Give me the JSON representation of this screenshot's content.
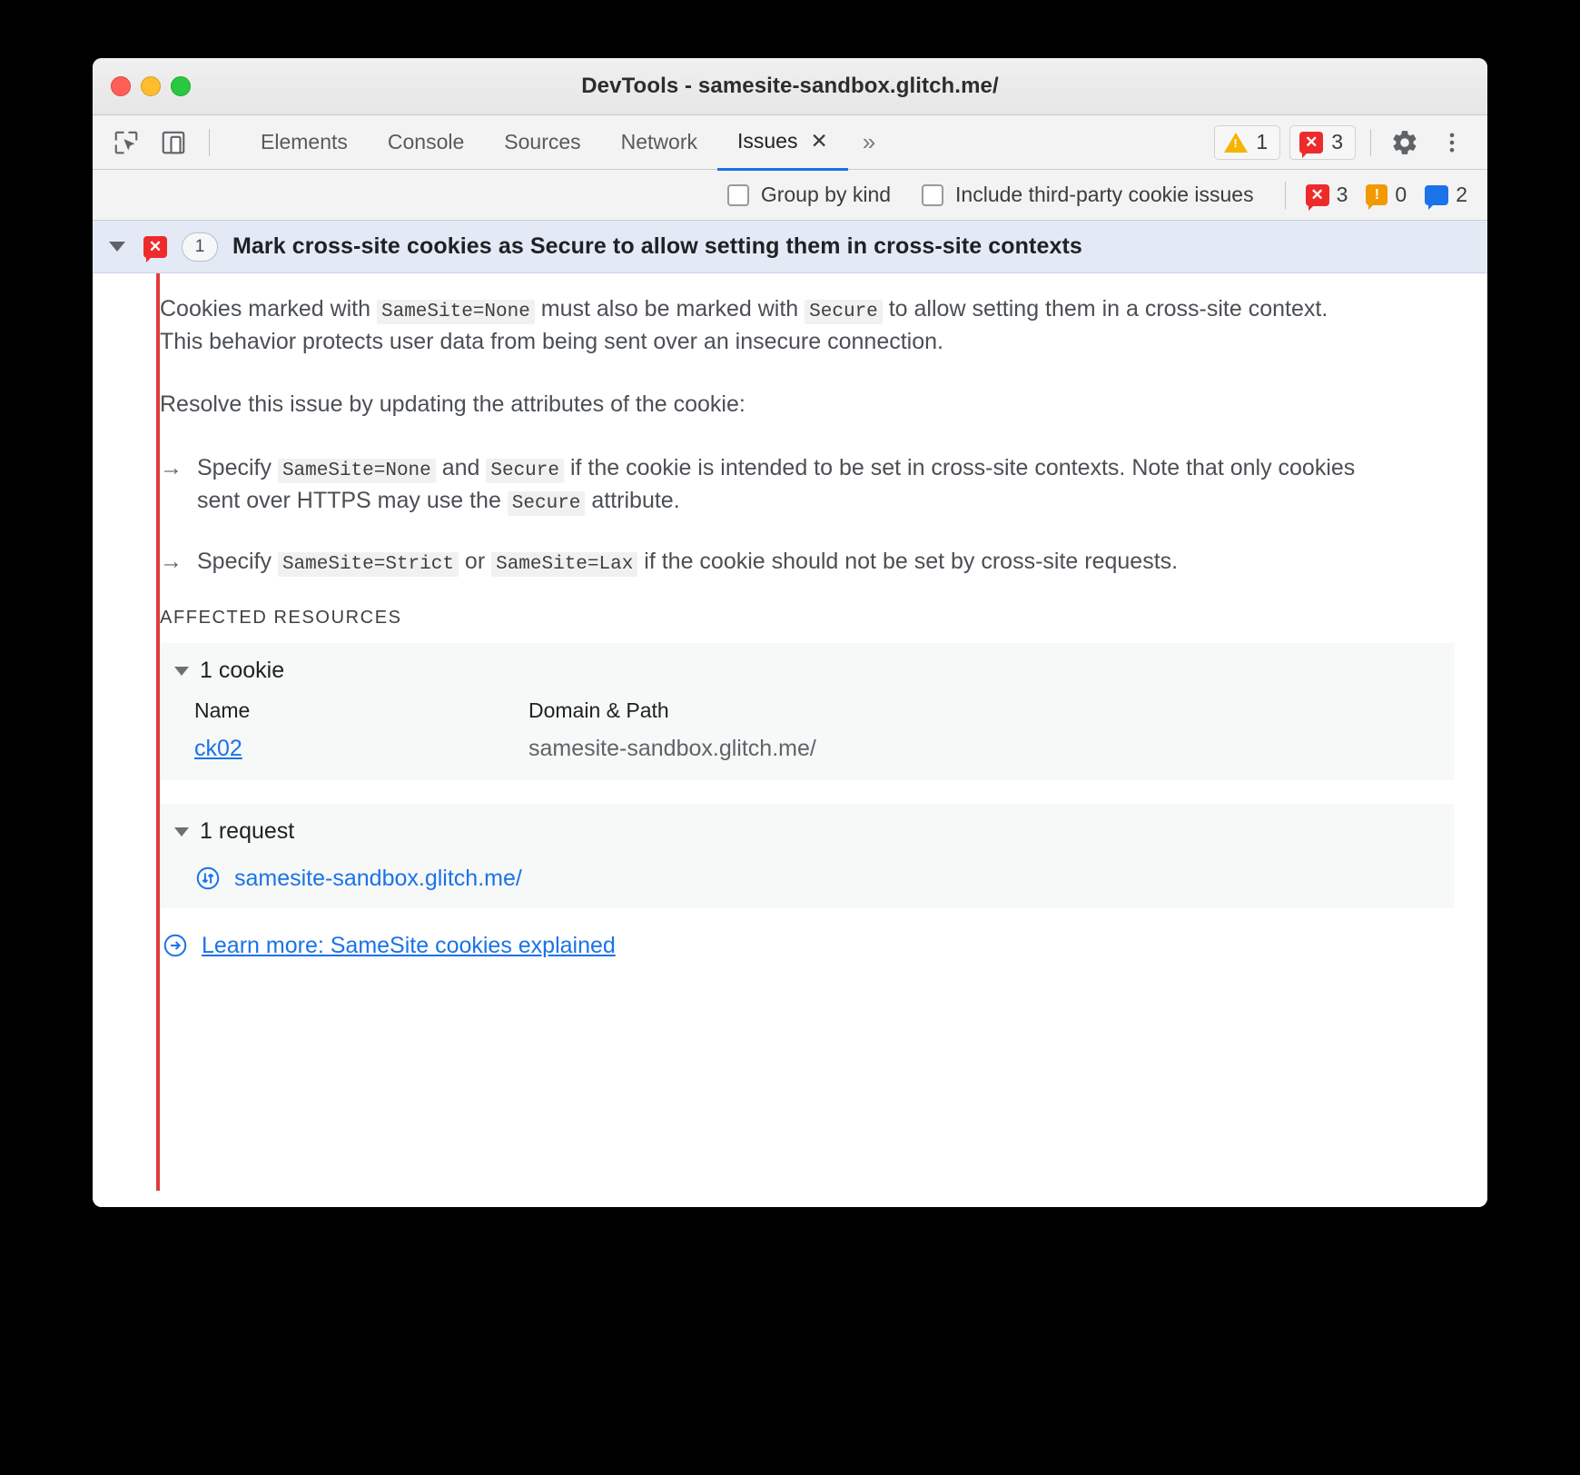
{
  "window": {
    "title": "DevTools - samesite-sandbox.glitch.me/",
    "traffic_lights": [
      "close",
      "minimize",
      "zoom"
    ]
  },
  "toolbar": {
    "left_icons": [
      "inspect-element-icon",
      "device-toolbar-icon"
    ],
    "tabs": [
      {
        "label": "Elements",
        "active": false
      },
      {
        "label": "Console",
        "active": false
      },
      {
        "label": "Sources",
        "active": false
      },
      {
        "label": "Network",
        "active": false
      },
      {
        "label": "Issues",
        "active": true,
        "closable": true
      }
    ],
    "more_tabs": "»",
    "warning_count": "1",
    "error_count": "3",
    "settings_icon": "gear-icon",
    "menu_icon": "kebab-menu-icon"
  },
  "filterbar": {
    "group_by_kind": {
      "label": "Group by kind",
      "checked": false
    },
    "include_third_party": {
      "label": "Include third-party cookie issues",
      "checked": false
    },
    "counts": {
      "errors": "3",
      "warnings": "0",
      "messages": "2"
    }
  },
  "issue": {
    "expanded": true,
    "severity": "error",
    "aggregate_count": "1",
    "title": "Mark cross-site cookies as Secure to allow setting them in cross-site contexts",
    "paragraph1": {
      "part1": "Cookies marked with ",
      "code1": "SameSite=None",
      "part2": " must also be marked with ",
      "code2": "Secure",
      "part3": " to allow setting them in a cross-site context. This behavior protects user data from being sent over an insecure connection."
    },
    "paragraph2": "Resolve this issue by updating the attributes of the cookie:",
    "bullets": [
      {
        "arrow": "→",
        "part1": "Specify ",
        "code1": "SameSite=None",
        "part2": " and ",
        "code2": "Secure",
        "part3": " if the cookie is intended to be set in cross-site contexts. Note that only cookies sent over HTTPS may use the ",
        "code3": "Secure",
        "part4": " attribute."
      },
      {
        "arrow": "→",
        "part1": "Specify ",
        "code1": "SameSite=Strict",
        "part2": " or ",
        "code2": "SameSite=Lax",
        "part3": " if the cookie should not be set by cross-site requests.",
        "code3": "",
        "part4": ""
      }
    ],
    "affected_resources_label": "AFFECTED RESOURCES",
    "cookies_section": {
      "summary": "1 cookie",
      "columns": {
        "name": "Name",
        "domain_path": "Domain & Path"
      },
      "rows": [
        {
          "name": "ck02",
          "domain_path": "samesite-sandbox.glitch.me/"
        }
      ]
    },
    "requests_section": {
      "summary": "1 request",
      "icon": "request-arrows-icon",
      "rows": [
        {
          "url": "samesite-sandbox.glitch.me/"
        }
      ]
    },
    "learn_more": {
      "icon": "arrow-circle-right-icon",
      "label": "Learn more: SameSite cookies explained"
    }
  },
  "colors": {
    "accent_blue": "#1a73e8",
    "error_red": "#ee2b2b",
    "warning_yellow": "#f5b400",
    "info_orange": "#f29900",
    "issue_header_bg": "#e3eaf6",
    "rail_red": "#e13c3c"
  }
}
